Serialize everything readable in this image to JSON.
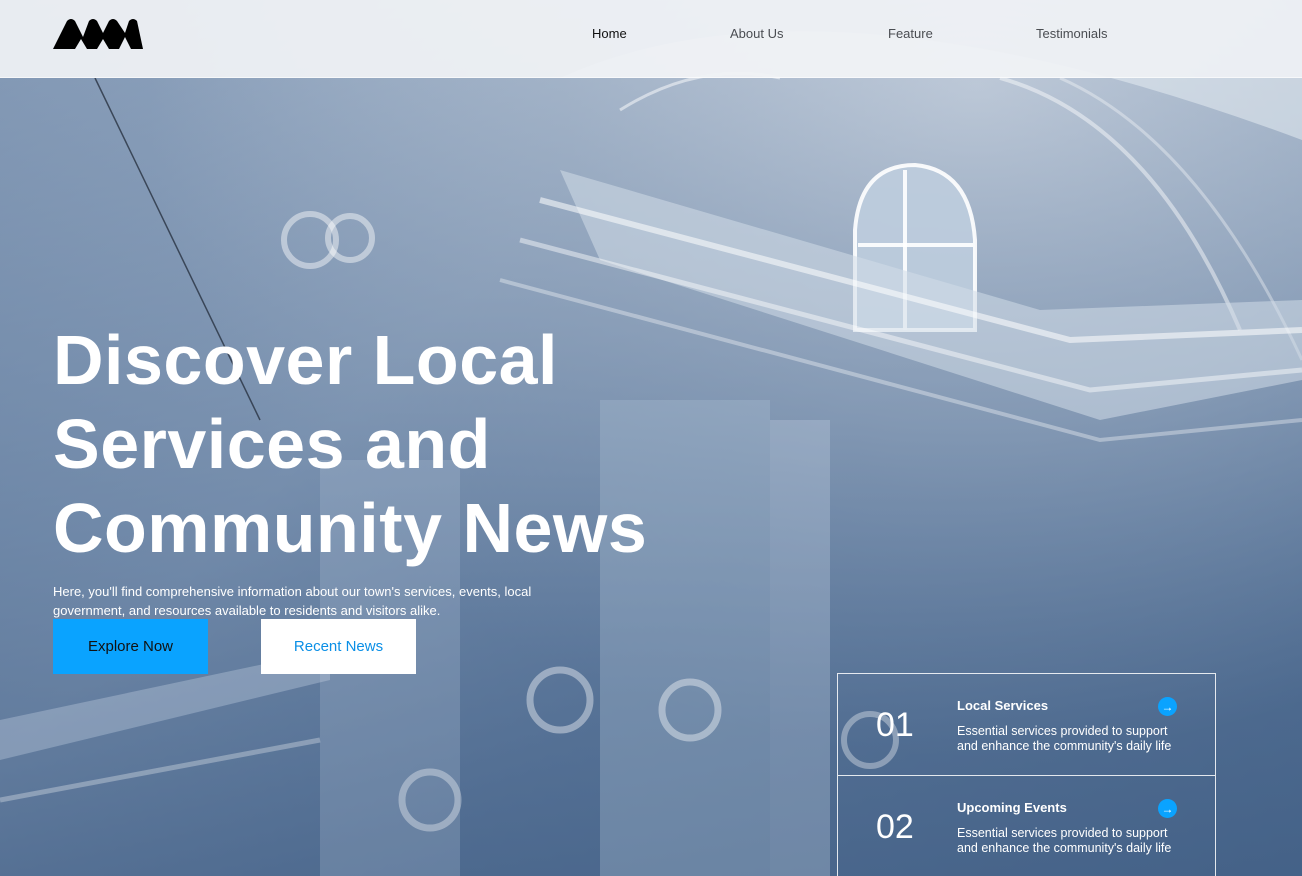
{
  "nav": {
    "logo_icon": "brand-logo",
    "items": [
      {
        "label": "Home",
        "active": true
      },
      {
        "label": "About Us",
        "active": false
      },
      {
        "label": "Feature",
        "active": false
      },
      {
        "label": "Testimonials",
        "active": false
      }
    ]
  },
  "hero": {
    "title_lines": [
      "Discover Local",
      "Services and",
      "Community News"
    ],
    "description": "Here, you'll find comprehensive information about our town's services, events, local government, and resources available to residents and visitors alike.",
    "primary_button": "Explore Now",
    "secondary_button": "Recent News"
  },
  "cards": [
    {
      "number": "01",
      "title": "Local Services",
      "description": "Essential services provided to support and enhance the community's daily life",
      "icon": "arrow-right-icon"
    },
    {
      "number": "02",
      "title": "Upcoming Events",
      "description": "Essential services provided to support and enhance the community's daily life",
      "icon": "arrow-right-icon"
    }
  ],
  "colors": {
    "accent": "#0aa3ff",
    "nav_bg": "#f0f2f5",
    "text_light": "#ffffff"
  }
}
